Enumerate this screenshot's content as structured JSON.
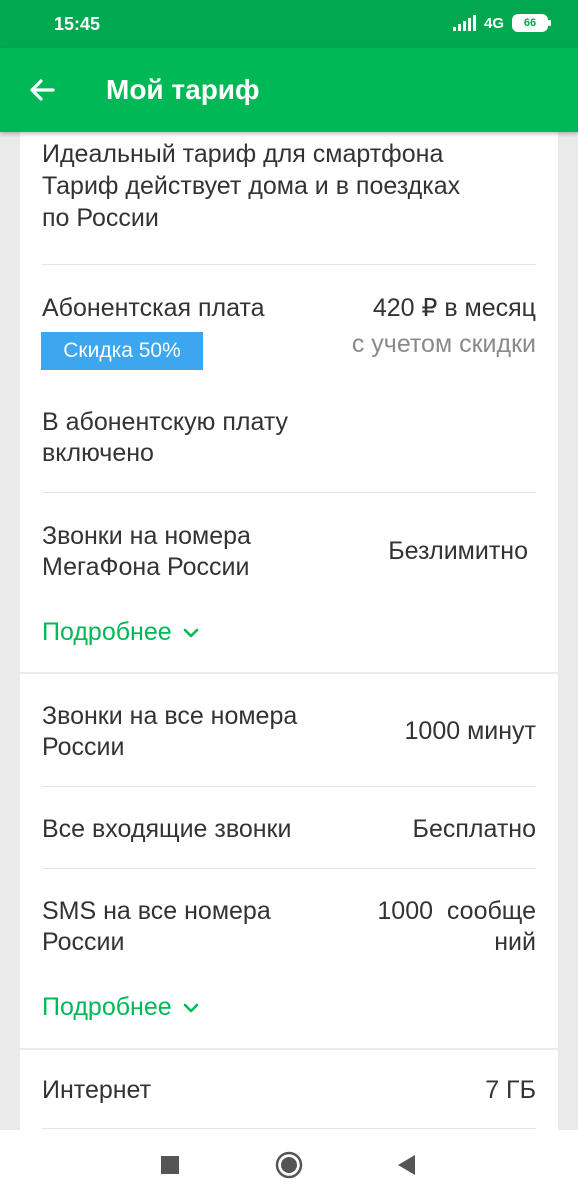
{
  "status_bar": {
    "time": "15:45",
    "network": "4G",
    "battery": "66"
  },
  "header": {
    "title": "Мой тариф",
    "back_icon": "arrow-left-icon"
  },
  "description": {
    "line1": "Идеальный тариф для смартфона",
    "line2": "Тариф действует дома и в поездках",
    "line3": "по России"
  },
  "fee": {
    "label": "Абонентская плата",
    "price": "420 ₽ в месяц",
    "note": "с учетом скидки",
    "badge": "Скидка 50%"
  },
  "included": {
    "line1": "В абонентскую плату",
    "line2": "включено"
  },
  "calls_megafon": {
    "line1": "Звонки на номера",
    "line2": "МегаФона России",
    "value": "Безлимитно"
  },
  "calls_all": {
    "line1": "Звонки на все номера",
    "line2": "России",
    "value": "1000 минут"
  },
  "incoming": {
    "label": "Все входящие звонки",
    "value": "Бесплатно"
  },
  "sms": {
    "line1": "SMS на все номера",
    "line2": "России",
    "value_line1": "1000  сообще",
    "value_line2": "ний"
  },
  "internet": {
    "label": "Интернет",
    "value": "7 ГБ"
  },
  "more_link": {
    "label": "Подробнее",
    "icon": "chevron-down-icon"
  },
  "colors": {
    "brand_green": "#00b956",
    "status_green": "#00a94f",
    "badge_blue": "#3ca6ee"
  },
  "nav": {
    "recent_icon": "square-icon",
    "home_icon": "circle-icon",
    "back_icon": "triangle-back-icon"
  }
}
